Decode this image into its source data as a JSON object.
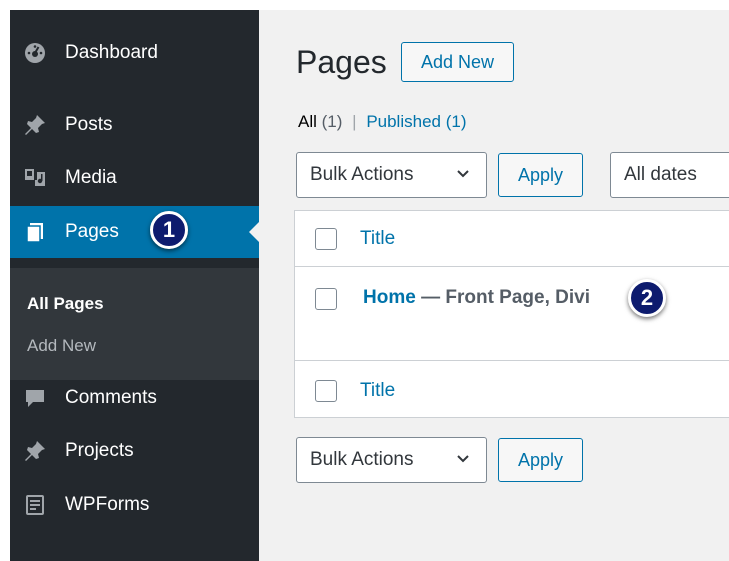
{
  "sidebar": {
    "items": [
      {
        "label": "Dashboard",
        "icon": "dashboard-icon"
      },
      {
        "label": "Posts",
        "icon": "pin-icon"
      },
      {
        "label": "Media",
        "icon": "media-icon"
      },
      {
        "label": "Pages",
        "icon": "pages-icon",
        "active": true
      },
      {
        "label": "Comments",
        "icon": "comment-icon"
      },
      {
        "label": "Projects",
        "icon": "pin-icon"
      },
      {
        "label": "WPForms",
        "icon": "form-icon"
      }
    ],
    "submenu": [
      {
        "label": "All Pages",
        "current": true
      },
      {
        "label": "Add New"
      }
    ]
  },
  "badges": {
    "one": "1",
    "two": "2"
  },
  "main": {
    "title": "Pages",
    "add_new": "Add New",
    "filters": {
      "all_label": "All",
      "all_count": "(1)",
      "separator": "|",
      "published_label": "Published",
      "published_count": "(1)"
    },
    "bulk_actions": "Bulk Actions",
    "apply": "Apply",
    "dates": "All dates",
    "table": {
      "header": "Title",
      "footer": "Title",
      "rows": [
        {
          "title": "Home",
          "state": "— Front Page, Divi"
        }
      ]
    }
  },
  "colors": {
    "sidebar": "#23282d",
    "accent": "#0073aa",
    "submenu": "#32373c",
    "badge": "#0d1b6e"
  }
}
